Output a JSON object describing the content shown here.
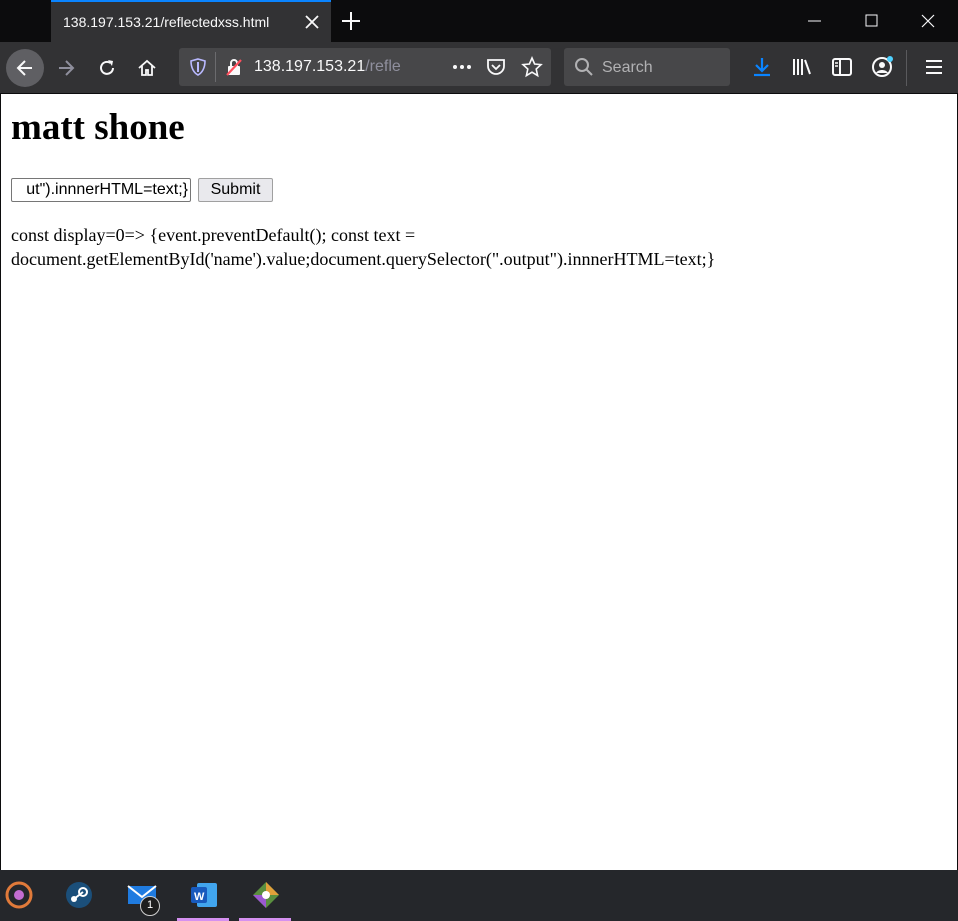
{
  "browser": {
    "tab": {
      "title": "138.197.153.21/reflectedxss.html"
    },
    "url": {
      "host": "138.197.153.21",
      "path": "/refle"
    },
    "search": {
      "placeholder": "Search"
    }
  },
  "page": {
    "heading": "matt shone",
    "form": {
      "input_value": "ut\").innnerHTML=text;}",
      "submit_label": "Submit"
    },
    "output": "const display=0=> {event.preventDefault(); const text = document.getElementById('name').value;document.querySelector(\".output\").innnerHTML=text;}"
  },
  "taskbar": {
    "mail_badge": "1"
  },
  "colors": {
    "accent": "#0a84ff",
    "toolbar": "#323234",
    "titlebar": "#0c0c0d"
  }
}
